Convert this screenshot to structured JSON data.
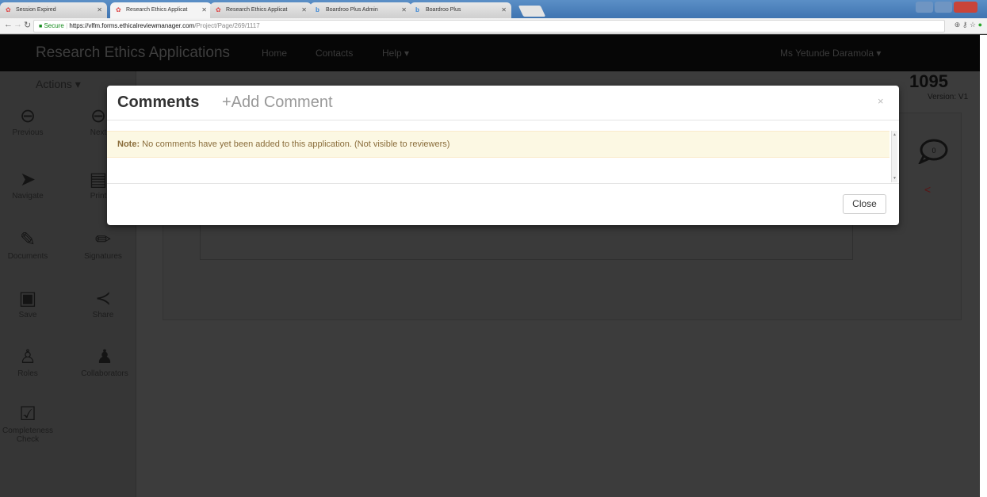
{
  "browser": {
    "tabs": [
      {
        "label": "Session Expired",
        "favicon": "ethics-favicon",
        "active": false
      },
      {
        "label": "Research Ethics Applicat",
        "favicon": "ethics-favicon",
        "active": true
      },
      {
        "label": "Research Ethics Applicat",
        "favicon": "ethics-favicon",
        "active": false
      },
      {
        "label": "Boardroo Plus Admin",
        "favicon": "boardroom-favicon",
        "active": false
      },
      {
        "label": "Boardroo Plus",
        "favicon": "boardroom-favicon",
        "active": false
      }
    ],
    "url_secure": "Secure",
    "url_host": "https://vlfm.forms.ethicalreviewmanager.com",
    "url_path": "/Project/Page/269/1117"
  },
  "appnav": {
    "brand": "Research Ethics Applications",
    "links": [
      "Home",
      "Contacts",
      "Help ▾"
    ],
    "user": "Ms Yetunde Daramola ▾"
  },
  "sidebar": {
    "actions_label": "Actions ▾",
    "buttons": [
      {
        "label": "Previous",
        "icon": "arrow-left-circle-icon",
        "glyph": "⊖"
      },
      {
        "label": "Next",
        "icon": "arrow-right-circle-icon",
        "glyph": "⊖"
      },
      {
        "label": "Navigate",
        "icon": "location-arrow-icon",
        "glyph": "➤"
      },
      {
        "label": "Print",
        "icon": "print-icon",
        "glyph": "▤"
      },
      {
        "label": "Documents",
        "icon": "paperclip-icon",
        "glyph": "✎"
      },
      {
        "label": "Signatures",
        "icon": "pencil-icon",
        "glyph": "✏"
      },
      {
        "label": "Save",
        "icon": "floppy-disk-icon",
        "glyph": "▣"
      },
      {
        "label": "Share",
        "icon": "share-icon",
        "glyph": "≺"
      },
      {
        "label": "Roles",
        "icon": "user-plus-icon",
        "glyph": "♙"
      },
      {
        "label": "Collaborators",
        "icon": "users-icon",
        "glyph": "♟"
      },
      {
        "label": "Completeness Check",
        "icon": "checkbox-icon",
        "glyph": "☑"
      }
    ]
  },
  "page": {
    "app_number": "1095",
    "version": "Version: V1",
    "comment_count": "0"
  },
  "modal": {
    "title": "Comments",
    "add_comment": "+Add Comment",
    "close_x": "×",
    "note_label": "Note:",
    "note_text": " No comments have yet been added to this application. (Not visible to reviewers)",
    "close_button": "Close"
  },
  "colors": {
    "note_bg": "#fcf8e3",
    "note_text": "#8a6d3b",
    "overlay": "#3c3c3c",
    "navbar": "#060606"
  }
}
